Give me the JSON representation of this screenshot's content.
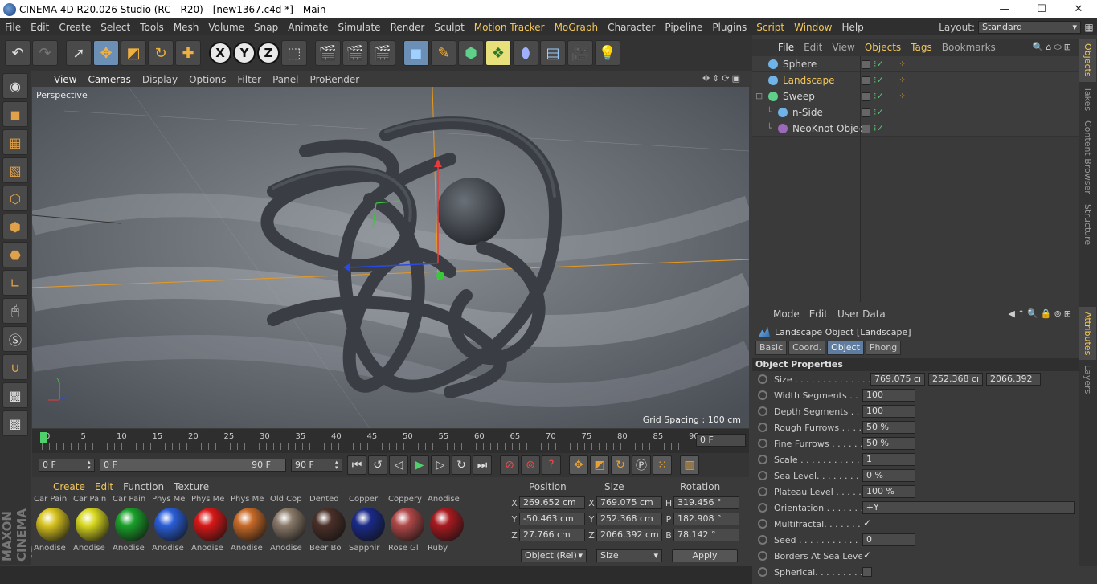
{
  "window": {
    "title": "CINEMA 4D R20.026 Studio (RC - R20) - [new1367.c4d *] - Main",
    "minimize": "—",
    "maximize": "☐",
    "close": "✕"
  },
  "menubar": {
    "items": [
      {
        "label": "File",
        "hl": false
      },
      {
        "label": "Edit",
        "hl": false
      },
      {
        "label": "Create",
        "hl": false
      },
      {
        "label": "Select",
        "hl": false
      },
      {
        "label": "Tools",
        "hl": false
      },
      {
        "label": "Mesh",
        "hl": false
      },
      {
        "label": "Volume",
        "hl": false
      },
      {
        "label": "Snap",
        "hl": false
      },
      {
        "label": "Animate",
        "hl": false
      },
      {
        "label": "Simulate",
        "hl": false
      },
      {
        "label": "Render",
        "hl": false
      },
      {
        "label": "Sculpt",
        "hl": false
      },
      {
        "label": "Motion Tracker",
        "hl": true
      },
      {
        "label": "MoGraph",
        "hl": true
      },
      {
        "label": "Character",
        "hl": false
      },
      {
        "label": "Pipeline",
        "hl": false
      },
      {
        "label": "Plugins",
        "hl": false
      },
      {
        "label": "Script",
        "hl": true
      },
      {
        "label": "Window",
        "hl": true
      },
      {
        "label": "Help",
        "hl": false
      }
    ],
    "layout_label": "Layout:",
    "layout_value": "Standard"
  },
  "viewport": {
    "menu": [
      "View",
      "Cameras",
      "Display",
      "Options",
      "Filter",
      "Panel",
      "ProRender"
    ],
    "camera_label": "Perspective",
    "grid_spacing": "Grid Spacing : 100 cm"
  },
  "timeline": {
    "ticks": [
      "0",
      "5",
      "10",
      "15",
      "20",
      "25",
      "30",
      "35",
      "40",
      "45",
      "50",
      "55",
      "60",
      "65",
      "70",
      "75",
      "80",
      "85",
      "90"
    ],
    "current_frame": "0 F"
  },
  "transport": {
    "start": "0 F",
    "range_start": "0 F",
    "range_end": "90 F",
    "end": "90 F"
  },
  "materials": {
    "menu": [
      {
        "label": "Create",
        "hl": true
      },
      {
        "label": "Edit",
        "hl": true
      },
      {
        "label": "Function",
        "hl": false
      },
      {
        "label": "Texture",
        "hl": false
      }
    ],
    "items": [
      {
        "top": "Car Pain",
        "bottom": "Anodise",
        "color": "#d8c420"
      },
      {
        "top": "Car Pain",
        "bottom": "Anodise",
        "color": "#d8d820"
      },
      {
        "top": "Car Pain",
        "bottom": "Anodise",
        "color": "#1aa02a"
      },
      {
        "top": "Phys Me",
        "bottom": "Anodise",
        "color": "#2a5ed8"
      },
      {
        "top": "Phys Me",
        "bottom": "Anodise",
        "color": "#d81818"
      },
      {
        "top": "Phys Me",
        "bottom": "Anodise",
        "color": "#c86a28"
      },
      {
        "top": "Old Cop",
        "bottom": "Anodise",
        "color": "#8a7a6a"
      },
      {
        "top": "Dented",
        "bottom": "Beer Bo",
        "color": "#4a3028"
      },
      {
        "top": "Copper",
        "bottom": "Sapphir",
        "color": "#1a2a88"
      },
      {
        "top": "Coppery",
        "bottom": "Rose Gl",
        "color": "#b04848"
      },
      {
        "top": "Anodise",
        "bottom": "Ruby",
        "color": "#a81a20"
      }
    ]
  },
  "coords": {
    "headers": [
      "Position",
      "Size",
      "Rotation"
    ],
    "rows": [
      {
        "a": "X",
        "pos": "269.652 cm",
        "s": "X",
        "size": "769.075 cm",
        "r": "H",
        "rot": "319.456 °"
      },
      {
        "a": "Y",
        "pos": "-50.463 cm",
        "s": "Y",
        "size": "252.368 cm",
        "r": "P",
        "rot": "182.908 °"
      },
      {
        "a": "Z",
        "pos": "27.766 cm",
        "s": "Z",
        "size": "2066.392 cm",
        "r": "B",
        "rot": "78.142 °"
      }
    ],
    "mode": "Object (Rel)",
    "size_mode": "Size",
    "apply": "Apply"
  },
  "objects": {
    "menu": [
      {
        "label": "File",
        "cls": "w"
      },
      {
        "label": "Edit",
        "cls": ""
      },
      {
        "label": "View",
        "cls": ""
      },
      {
        "label": "Objects",
        "cls": "hl"
      },
      {
        "label": "Tags",
        "cls": "hl"
      },
      {
        "label": "Bookmarks",
        "cls": ""
      }
    ],
    "items": [
      {
        "name": "Sphere",
        "indent": 0,
        "selected": false,
        "icon": "#6fb3e8",
        "tag": true
      },
      {
        "name": "Landscape",
        "indent": 0,
        "selected": true,
        "icon": "#6fb3e8",
        "tag": true
      },
      {
        "name": "Sweep",
        "indent": 0,
        "selected": false,
        "icon": "#5fd08a",
        "tag": true
      },
      {
        "name": "n-Side",
        "indent": 1,
        "selected": false,
        "icon": "#6fb3e8",
        "tag": false
      },
      {
        "name": "NeoKnot Object",
        "indent": 1,
        "selected": false,
        "icon": "#9a6ab8",
        "tag": false
      }
    ]
  },
  "right_tabs": [
    {
      "label": "Objects",
      "a": true
    },
    {
      "label": "Takes",
      "a": false
    },
    {
      "label": "Content Browser",
      "a": false
    },
    {
      "label": "Structure",
      "a": false
    }
  ],
  "right_tabs2": [
    {
      "label": "Attributes",
      "a": true
    },
    {
      "label": "Layers",
      "a": false
    }
  ],
  "attributes": {
    "menu": [
      "Mode",
      "Edit",
      "User Data"
    ],
    "title": "Landscape Object [Landscape]",
    "tabs": [
      {
        "label": "Basic",
        "a": false
      },
      {
        "label": "Coord.",
        "a": false
      },
      {
        "label": "Object",
        "a": true
      },
      {
        "label": "Phong",
        "a": false
      }
    ],
    "section": "Object Properties",
    "size": {
      "label": "Size . . . . . . . . . . . . . .",
      "x": "769.075 cı",
      "y": "252.368 cı",
      "z": "2066.392"
    },
    "rows": [
      {
        "label": "Width Segments . . .",
        "value": "100"
      },
      {
        "label": "Depth Segments . . .",
        "value": "100"
      },
      {
        "label": "Rough Furrows . . . .",
        "value": "50 %"
      },
      {
        "label": "Fine Furrows . . . . . .",
        "value": "50 %"
      },
      {
        "label": "Scale . . . . . . . . . . . .",
        "value": "1"
      },
      {
        "label": "Sea Level. . . . . . . . .",
        "value": "0 %"
      },
      {
        "label": "Plateau Level . . . . .",
        "value": "100 %"
      }
    ],
    "orientation": {
      "label": "Orientation . . . . . . .",
      "value": "+Y"
    },
    "multifractal": {
      "label": "Multifractal. . . . . . .",
      "check": "✓"
    },
    "seed": {
      "label": "Seed . . . . . . . . . . . .",
      "value": "0"
    },
    "borders": {
      "label": "Borders At Sea Level",
      "check": "✓"
    },
    "spherical": {
      "label": "Spherical. . . . . . . . .",
      "check": ""
    }
  }
}
